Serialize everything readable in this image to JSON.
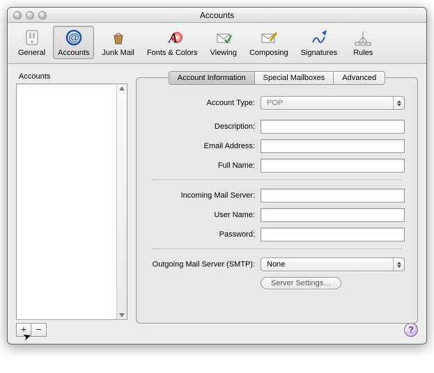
{
  "window": {
    "title": "Accounts"
  },
  "toolbar": {
    "general": "General",
    "accounts": "Accounts",
    "junk": "Junk Mail",
    "fonts": "Fonts & Colors",
    "viewing": "Viewing",
    "composing": "Composing",
    "signatures": "Signatures",
    "rules": "Rules"
  },
  "sidebar": {
    "heading": "Accounts"
  },
  "tabs": {
    "info": "Account Information",
    "special": "Special Mailboxes",
    "advanced": "Advanced"
  },
  "form": {
    "account_type_label": "Account Type:",
    "account_type_value": "POP",
    "description_label": "Description:",
    "description_value": "",
    "email_label": "Email Address:",
    "email_value": "",
    "fullname_label": "Full Name:",
    "fullname_value": "",
    "incoming_label": "Incoming Mail Server:",
    "incoming_value": "",
    "username_label": "User Name:",
    "username_value": "",
    "password_label": "Password:",
    "password_value": "",
    "smtp_label": "Outgoing Mail Server (SMTP):",
    "smtp_value": "None",
    "server_settings_btn": "Server Settings…"
  },
  "buttons": {
    "add": "+",
    "remove": "−",
    "help": "?"
  }
}
